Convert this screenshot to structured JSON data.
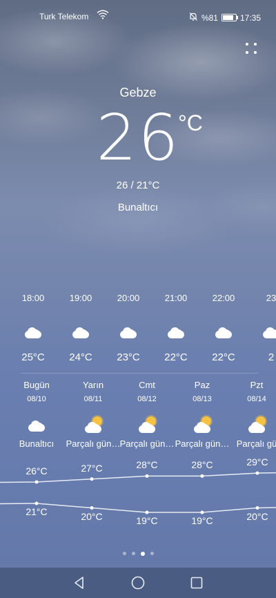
{
  "status_bar": {
    "carrier": "Turk Telekom",
    "battery": "%81",
    "time": "17:35",
    "battery_level": 0.81
  },
  "current": {
    "city": "Gebze",
    "temp": "26",
    "unit": "°C",
    "range": "26 / 21°C",
    "condition": "Bunaltıcı"
  },
  "hourly": [
    {
      "time": "18:00",
      "icon": "cloud-icon",
      "temp": "25°C"
    },
    {
      "time": "19:00",
      "icon": "cloud-icon",
      "temp": "24°C"
    },
    {
      "time": "20:00",
      "icon": "cloud-icon",
      "temp": "23°C"
    },
    {
      "time": "21:00",
      "icon": "cloud-icon",
      "temp": "22°C"
    },
    {
      "time": "22:00",
      "icon": "cloud-icon",
      "temp": "22°C"
    },
    {
      "time": "23",
      "icon": "cloud-icon",
      "temp": "2"
    }
  ],
  "daily": [
    {
      "day": "Bugün",
      "date": "08/10",
      "icon": "cloud-icon",
      "desc": "Bunaltıcı",
      "high": "26°C",
      "low": "21°C"
    },
    {
      "day": "Yarın",
      "date": "08/11",
      "icon": "partly-sunny-icon",
      "desc": "Parçalı gün…",
      "high": "27°C",
      "low": "20°C"
    },
    {
      "day": "Cmt",
      "date": "08/12",
      "icon": "partly-sunny-icon",
      "desc": "Parçalı gün…",
      "high": "28°C",
      "low": "19°C"
    },
    {
      "day": "Paz",
      "date": "08/13",
      "icon": "partly-sunny-icon",
      "desc": "Parçalı gün…",
      "high": "28°C",
      "low": "19°C"
    },
    {
      "day": "Pzt",
      "date": "08/14",
      "icon": "partly-sunny-icon",
      "desc": "Parçalı gü",
      "high": "29°C",
      "low": "20°C"
    }
  ],
  "pagination": {
    "count": 4,
    "active": 2
  },
  "colors": {
    "accent_sun": "#f5c242",
    "navbar": "#4b5c82"
  }
}
